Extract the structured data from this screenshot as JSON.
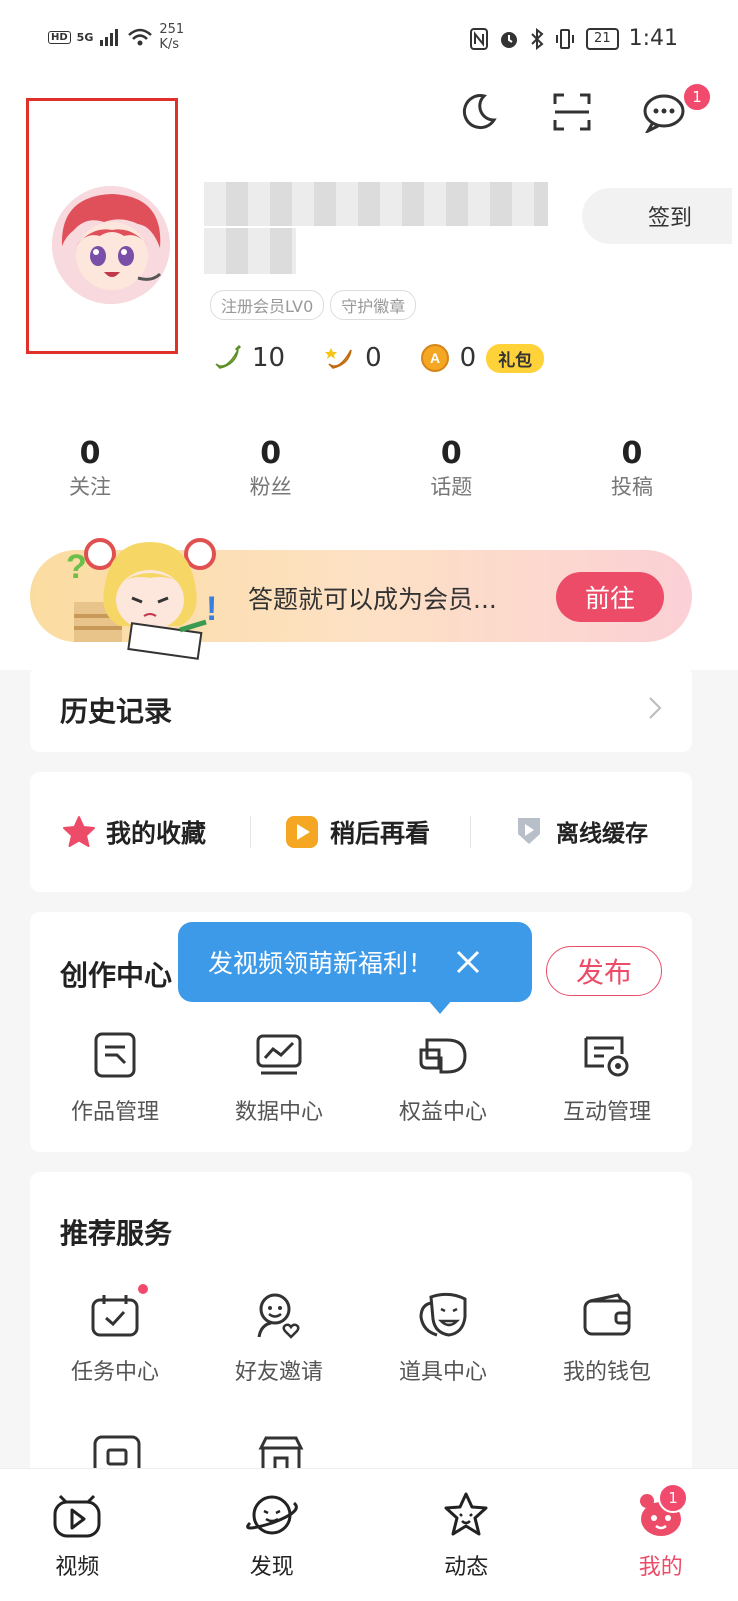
{
  "status_bar": {
    "network": "HD",
    "signal": "5G",
    "speed_value": "251",
    "speed_unit": "K/s",
    "battery": "21",
    "time": "1:41"
  },
  "header": {
    "message_badge": "1",
    "checkin_label": "签到"
  },
  "profile": {
    "tags": [
      "注册会员LV0",
      "守护徽章"
    ],
    "currencies": [
      {
        "icon": "banana-icon",
        "value": "10"
      },
      {
        "icon": "golden-banana-icon",
        "value": "0"
      },
      {
        "icon": "coin-icon",
        "value": "0"
      }
    ],
    "gift_label": "礼包"
  },
  "stats": [
    {
      "value": "0",
      "label": "关注"
    },
    {
      "value": "0",
      "label": "粉丝"
    },
    {
      "value": "0",
      "label": "话题"
    },
    {
      "value": "0",
      "label": "投稿"
    }
  ],
  "banner": {
    "text": "答题就可以成为会员...",
    "button": "前往"
  },
  "history": {
    "title": "历史记录"
  },
  "quick": [
    {
      "label": "我的收藏",
      "icon": "star-icon"
    },
    {
      "label": "稍后再看",
      "icon": "play-later-icon"
    },
    {
      "label": "离线缓存",
      "icon": "download-icon"
    }
  ],
  "creation": {
    "title": "创作中心",
    "publish": "发布",
    "tooltip": "发视频领萌新福利！",
    "items": [
      {
        "label": "作品管理",
        "icon": "works-icon"
      },
      {
        "label": "数据中心",
        "icon": "data-chart-icon"
      },
      {
        "label": "权益中心",
        "icon": "rights-icon"
      },
      {
        "label": "互动管理",
        "icon": "interaction-icon"
      }
    ]
  },
  "services": {
    "title": "推荐服务",
    "items": [
      {
        "label": "任务中心",
        "icon": "task-calendar-icon"
      },
      {
        "label": "好友邀请",
        "icon": "invite-friend-icon"
      },
      {
        "label": "道具中心",
        "icon": "mask-icon"
      },
      {
        "label": "我的钱包",
        "icon": "wallet-icon"
      }
    ]
  },
  "tabbar": {
    "items": [
      {
        "label": "视频",
        "icon": "video-tab-icon"
      },
      {
        "label": "发现",
        "icon": "planet-tab-icon"
      },
      {
        "label": "动态",
        "icon": "star-face-tab-icon"
      },
      {
        "label": "我的",
        "icon": "me-tab-icon"
      }
    ],
    "me_badge": "1"
  },
  "colors": {
    "accent": "#ec4c68",
    "tooltip": "#3d9ae8",
    "highlight_box": "#e0302a"
  }
}
